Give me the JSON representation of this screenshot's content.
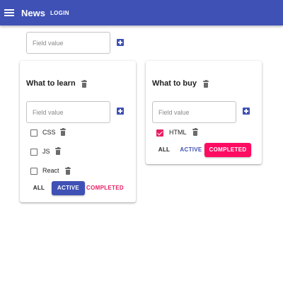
{
  "appbar": {
    "title": "News",
    "login_label": "LOGIN",
    "menu_icon": "hamburger-menu-icon",
    "color": "#3f51b5"
  },
  "new_todolist": {
    "placeholder": "Field value"
  },
  "todolists": [
    {
      "title": "What to learn",
      "input_placeholder": "Field value",
      "tasks": [
        {
          "label": "CSS",
          "checked": false
        },
        {
          "label": "JS",
          "checked": false
        },
        {
          "label": "React",
          "checked": false
        }
      ],
      "filters": {
        "all": "ALL",
        "active": "ACTIVE",
        "completed": "COMPLETED"
      },
      "selected_filter": "active"
    },
    {
      "title": "What to buy",
      "input_placeholder": "Field value",
      "tasks": [
        {
          "label": "HTML",
          "checked": true
        }
      ],
      "filters": {
        "all": "ALL",
        "active": "ACTIVE",
        "completed": "COMPLETED"
      },
      "selected_filter": "completed"
    }
  ],
  "colors": {
    "primary": "#3f51b5",
    "secondary": "#e91e63",
    "completed_button": "#ff0b62"
  }
}
